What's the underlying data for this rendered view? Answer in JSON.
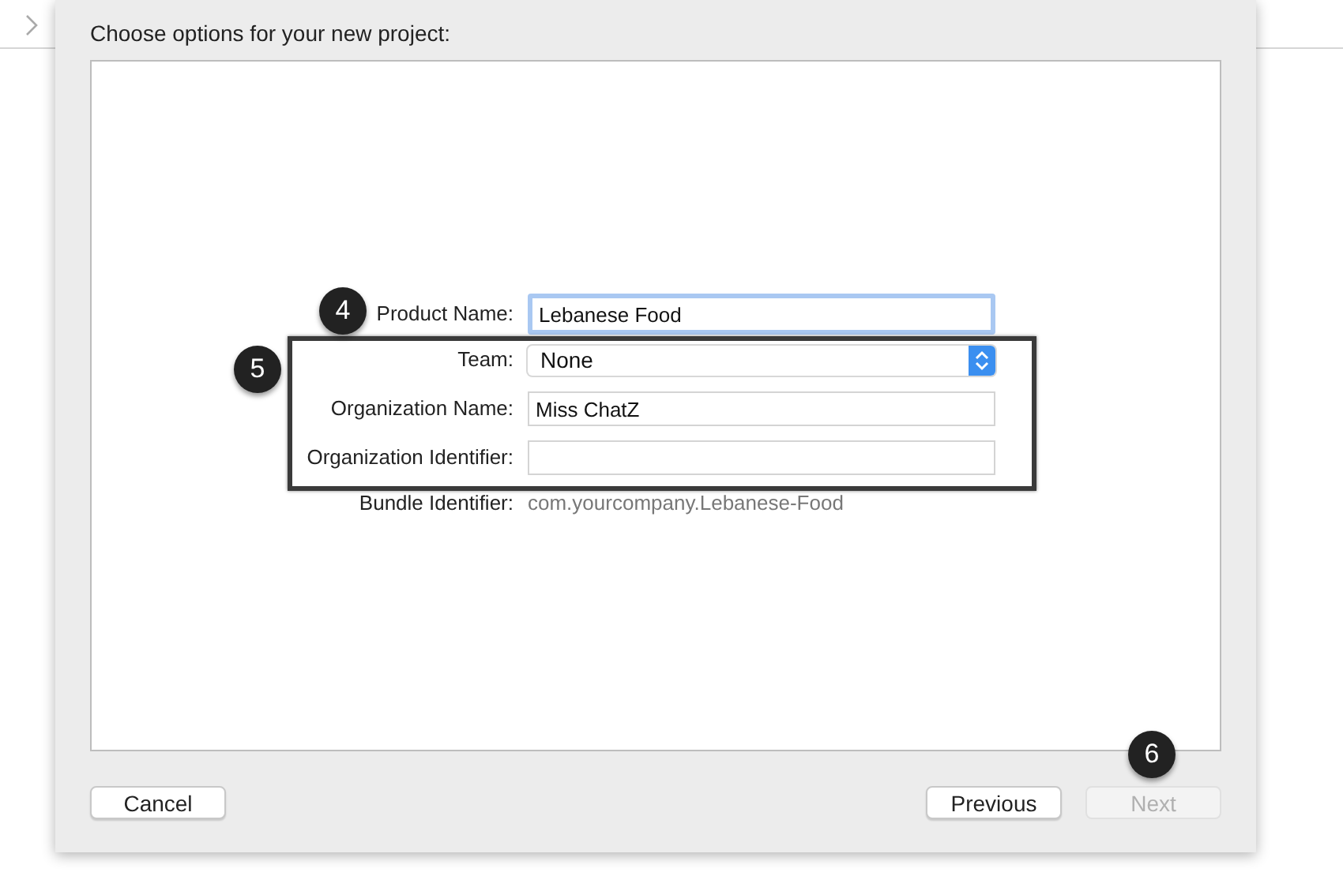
{
  "dialog": {
    "title": "Choose options for your new project:"
  },
  "fields": [
    {
      "kind": "text",
      "label": "Product Name:",
      "value": "Lebanese Food",
      "focused": true
    },
    {
      "kind": "popup",
      "label": "Team:",
      "value": "None"
    },
    {
      "kind": "text",
      "label": "Organization Name:",
      "value": "Miss ChatZ",
      "focused": false
    },
    {
      "kind": "text",
      "label": "Organization Identifier:",
      "focused": false
    },
    {
      "kind": "static",
      "label": "Bundle Identifier:",
      "value": "com.yourcompany.Lebanese-Food"
    }
  ],
  "callouts": [
    "4",
    "5",
    "6"
  ],
  "buttons": [
    {
      "label": "Cancel",
      "enabled": true
    },
    {
      "label": "Previous",
      "enabled": true
    },
    {
      "label": "Next",
      "enabled": false
    }
  ]
}
